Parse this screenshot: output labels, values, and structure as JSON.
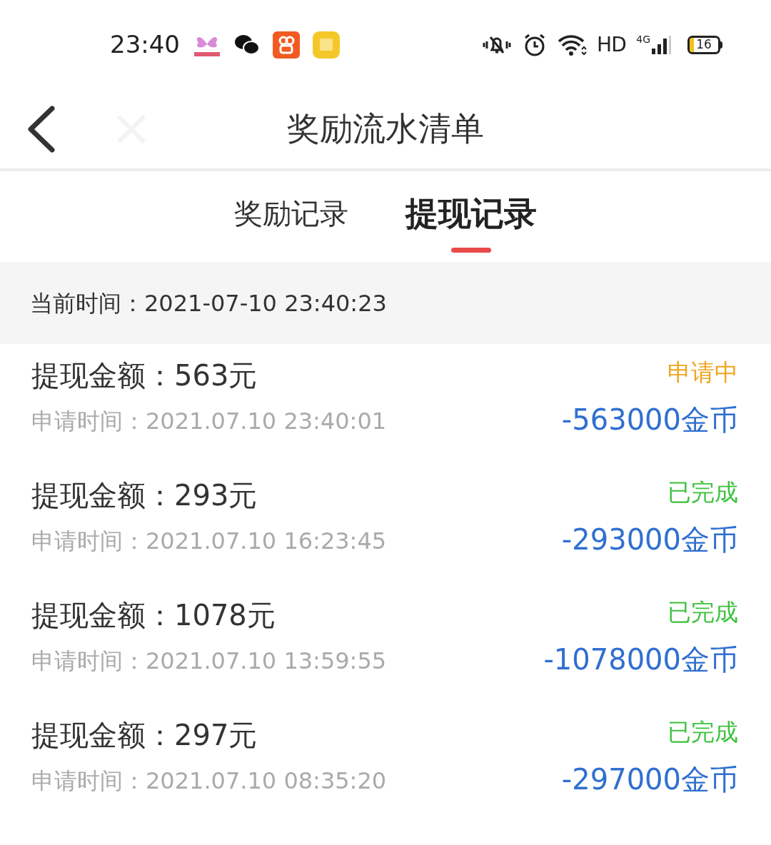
{
  "status_bar": {
    "time": "23:40",
    "battery": "16",
    "network": "HD",
    "signal_type": "4G"
  },
  "header": {
    "title": "奖励流水清单"
  },
  "tabs": [
    {
      "label": "奖励记录",
      "selected": false
    },
    {
      "label": "提现记录",
      "selected": true
    }
  ],
  "current_time": "当前时间：2021-07-10 23:40:23",
  "records": [
    {
      "amount": "提现金额：563元",
      "applied": "申请时间：2021.07.10 23:40:01",
      "status": "申请中",
      "color": "#f0a41e",
      "coins": "-563000金币"
    },
    {
      "amount": "提现金额：293元",
      "applied": "申请时间：2021.07.10 16:23:45",
      "status": "已完成",
      "color": "#3ec23e",
      "coins": "-293000金币"
    },
    {
      "amount": "提现金额：1078元",
      "applied": "申请时间：2021.07.10 13:59:55",
      "status": "已完成",
      "color": "#3ec23e",
      "coins": "-1078000金币"
    },
    {
      "amount": "提现金额：297元",
      "applied": "申请时间：2021.07.10 08:35:20",
      "status": "已完成",
      "color": "#3ec23e",
      "coins": "-297000金币"
    }
  ]
}
